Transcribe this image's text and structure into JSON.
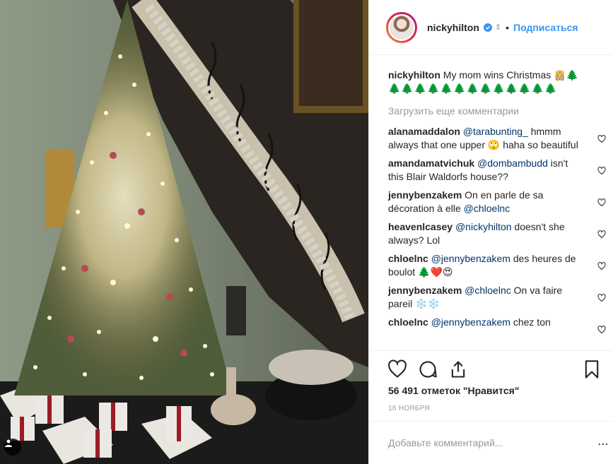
{
  "post": {
    "username": "nickyhilton",
    "follow_label": "Подписаться",
    "dot": "•"
  },
  "caption": {
    "username": "nickyhilton",
    "text": "My mom wins Christmas 👸🏼🌲",
    "trees": "🌲🌲🌲🌲🌲🌲🌲🌲🌲🌲🌲🌲🌲"
  },
  "load_more_label": "Загрузить еще комментарии",
  "comments": [
    {
      "user": "alanamaddalon",
      "mention": "@tarabunting_",
      "text": " hmmm always that one upper 🙄 haha so beautiful"
    },
    {
      "user": "amandamatvichuk",
      "mention": "@dombambudd",
      "text": " isn't this Blair Waldorfs house??"
    },
    {
      "user": "jennybenzakem",
      "mention": "",
      "text": "On en parle de sa décoration à elle ",
      "mention2": "@chloelnc"
    },
    {
      "user": "heavenlcasey",
      "mention": "@nickyhilton",
      "text": " doesn't she always? Lol"
    },
    {
      "user": "chloelnc",
      "mention": "@jennybenzakem",
      "text": " des heures de boulot 🌲❤️😍"
    },
    {
      "user": "jennybenzakem",
      "mention": "@chloelnc",
      "text": " On va faire pareil ❄️❄️"
    },
    {
      "user": "chloelnc",
      "mention": "@jennybenzakem",
      "text": " chez ton"
    }
  ],
  "likes_text": "56 491 отметок \"Нравится\"",
  "date_text": "16 НОЯБРЯ",
  "add_comment_placeholder": "Добавьте комментарий...",
  "colors": {
    "link": "#3897f0",
    "mention": "#003569",
    "tree_green": "#1e8d2f"
  }
}
